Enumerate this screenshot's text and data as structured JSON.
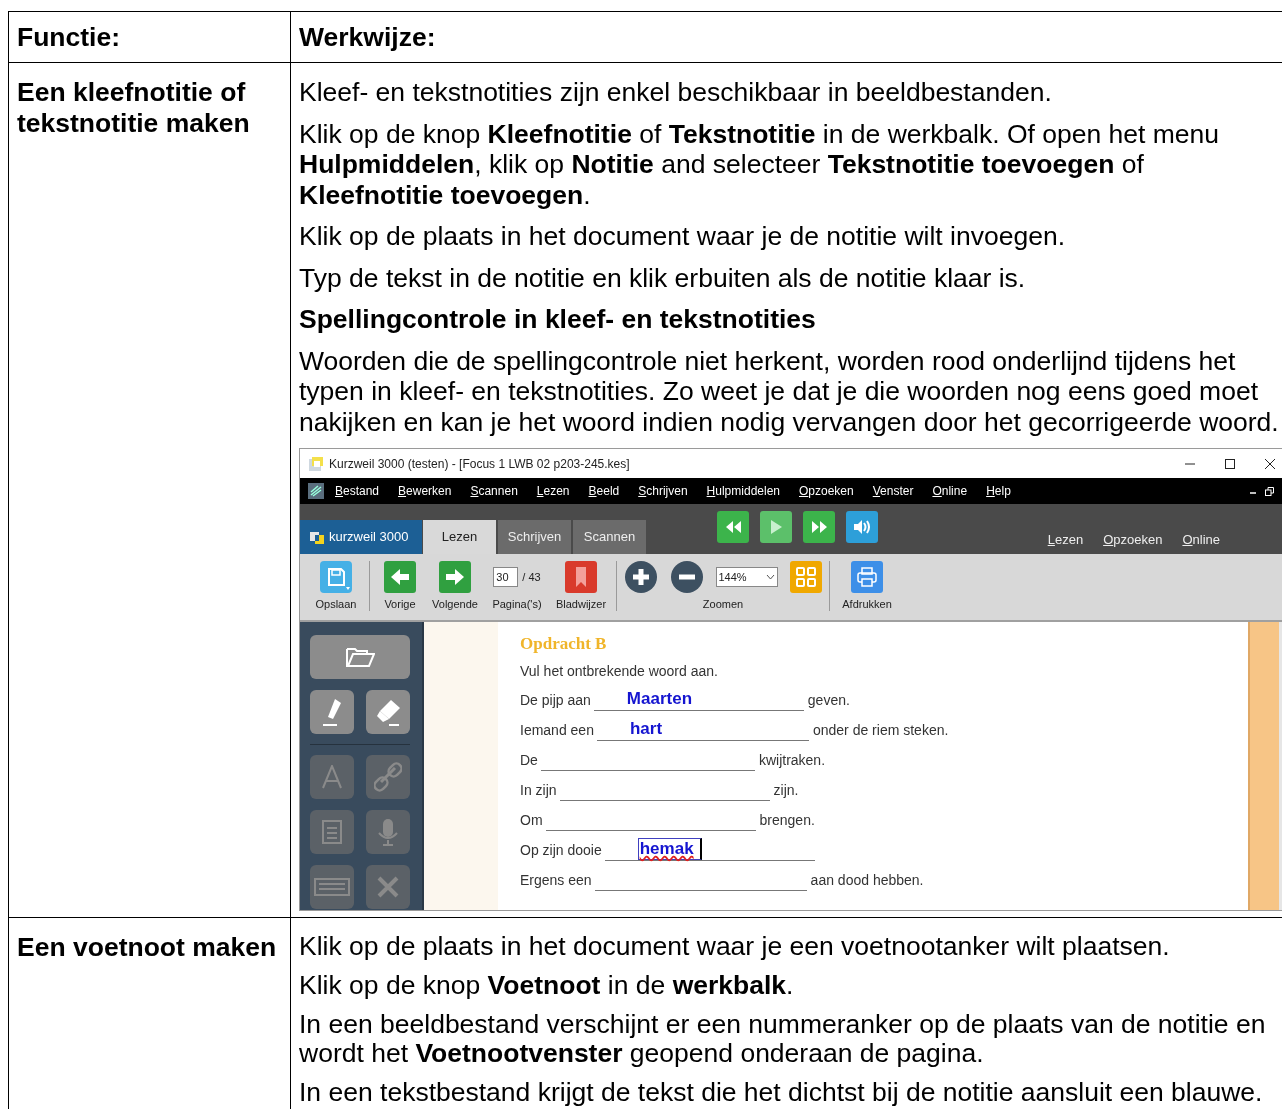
{
  "table": {
    "columns": [
      "Functie:",
      "Werkwijze:"
    ],
    "rows": [
      {
        "function": "Een kleefnotitie of tekstnotitie maken",
        "content": [
          {
            "kind": "text",
            "text": "Kleef- en tekstnotities zijn enkel beschikbaar in beeldbestanden."
          },
          {
            "kind": "text",
            "text": "Klik op de knop **Kleefnotitie** of **Tekstnotitie** in de werkbalk. Of open het menu **Hulpmiddelen**, klik op **Notitie** and selecteer **Tekstnotitie toevoegen** of **Kleefnotitie toevoegen**."
          },
          {
            "kind": "text",
            "text": "Klik op de plaats in het document waar je de notitie wilt invoegen."
          },
          {
            "kind": "text",
            "text": "Typ de tekst in de notitie en klik erbuiten als de notitie klaar is."
          },
          {
            "kind": "heading",
            "text": "Spellingcontrole in kleef- en tekstnotities"
          },
          {
            "kind": "text",
            "text": "Woorden die de spellingcontrole niet herkent, worden rood onderlijnd tijdens het typen in kleef- en tekstnotities. Zo weet je dat je die woorden nog eens goed moet nakijken en kan je het woord indien nodig vervangen door het gecorrigeerde woord."
          },
          {
            "kind": "screenshot"
          }
        ]
      },
      {
        "function": "Een voetnoot maken",
        "content": [
          {
            "kind": "text",
            "text": "Klik op de plaats in het document waar je een voetnootanker wilt plaatsen."
          },
          {
            "kind": "text",
            "text": "Klik op de knop **Voetnoot** in de **werkbalk**."
          },
          {
            "kind": "text",
            "text": "In een beeldbestand verschijnt er een nummeranker op de plaats van de notitie en wordt het **Voetnootvenster** geopend onderaan de pagina."
          },
          {
            "kind": "text",
            "text": "In een tekstbestand krijgt de tekst die het dichtst bij de notitie aansluit een blauwe."
          }
        ]
      }
    ]
  },
  "screenshot": {
    "window_title": "Kurzweil 3000 (testen) - [Focus 1 LWB 02 p203-245.kes]",
    "menu": [
      "Bestand",
      "Bewerken",
      "Scannen",
      "Lezen",
      "Beeld",
      "Schrijven",
      "Hulpmiddelen",
      "Opzoeken",
      "Venster",
      "Online",
      "Help"
    ],
    "logo_text": "kurzweil 3000",
    "tabs": [
      {
        "label": "Lezen",
        "selected": true
      },
      {
        "label": "Schrijven",
        "selected": false
      },
      {
        "label": "Scannen",
        "selected": false
      }
    ],
    "quick_links": [
      "Lezen",
      "Opzoeken",
      "Online"
    ],
    "toolbar": {
      "save": "Opslaan",
      "previous": "Vorige",
      "next": "Volgende",
      "page_value": "30",
      "page_total": "/ 43",
      "page_label": "Pagina('s)",
      "bookmark": "Bladwijzer",
      "zoom_value": "144%",
      "zoom_label": "Zoomen",
      "print": "Afdrukken"
    },
    "side_tools": [
      {
        "kind": "open",
        "disabled": false
      },
      {
        "kind": "highlight",
        "disabled": false
      },
      {
        "kind": "erase",
        "disabled": false
      },
      {
        "kind": "text",
        "disabled": true
      },
      {
        "kind": "link",
        "disabled": true
      },
      {
        "kind": "paste",
        "disabled": true
      },
      {
        "kind": "dictate",
        "disabled": true
      },
      {
        "kind": "keyboard",
        "disabled": true
      },
      {
        "kind": "close",
        "disabled": true
      }
    ],
    "exercise": {
      "title": "Opdracht B",
      "instruction": "Vul het ontbrekende woord aan.",
      "lines": [
        {
          "kind": "filled",
          "before": "De pijp aan",
          "answer": "Maarten",
          "after": "geven."
        },
        {
          "kind": "filled",
          "before": "Iemand een",
          "answer": "hart",
          "after": "onder de riem steken."
        },
        {
          "kind": "blank",
          "before": "De",
          "after": "kwijtraken."
        },
        {
          "kind": "blank",
          "before": "In zijn",
          "after": "zijn."
        },
        {
          "kind": "blank",
          "before": "Om",
          "after": "brengen."
        },
        {
          "kind": "editing",
          "before": "Op zijn dooie",
          "answer": "hemak"
        },
        {
          "kind": "blank",
          "before": "Ergens een",
          "after": "aan dood hebben."
        }
      ]
    }
  }
}
